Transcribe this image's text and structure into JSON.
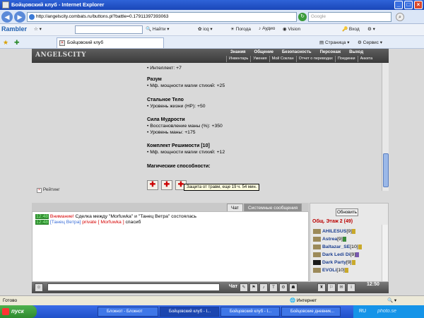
{
  "window": {
    "title": "Бойцовский клуб - Internet Explorer",
    "url": "http://angelscity.combats.ru/buttons.pl?battle=0.17911397393063",
    "search_placeholder": "Google"
  },
  "toolbar": {
    "brand": "Rambler",
    "items": [
      "Найти",
      "Погода",
      "Аудио",
      "Vision",
      "Вход"
    ],
    "icq": "icq"
  },
  "tab": {
    "title": "Бойцовский клуб",
    "page_menu": "Страница",
    "tools_menu": "Сервис"
  },
  "game": {
    "logo": "ANGELSCITY",
    "menu_top": [
      "Знания",
      "Общение",
      "Безопасность",
      "Персонаж",
      "Выход"
    ],
    "menu_bottom": [
      "Инвентарь",
      "Умения",
      "Мой Соклан",
      "Отчет о переводах",
      "Поединки",
      "Анкета"
    ],
    "partial_line": "• Интеллект: +7",
    "blocks": [
      {
        "title": "Разум",
        "lines": [
          "• Мф. мощности магии стихий: +25"
        ]
      },
      {
        "title": "Стальное Тело",
        "lines": [
          "• Уровень жизни (HP): +50"
        ]
      },
      {
        "title": "Сила Мудрости",
        "lines": [
          "• Восстановление маны (%): +350",
          "• Уровень маны: +175"
        ]
      },
      {
        "title": "Комплект Решимости [10]",
        "lines": [
          "• Мф. мощности магии стихий: +12"
        ]
      }
    ],
    "magic_title": "Магические способности:",
    "tooltip": "Защита от травм, еще 19 ч. 54 мин.",
    "rating": "Рейтинг"
  },
  "chat": {
    "tabs": [
      "Чат",
      "Системные сообщения"
    ],
    "lines": [
      {
        "time": "12:48",
        "alert": "Внимание!",
        "text": " Сделка между \"Morfuwka\" и \"Танец Ветра\" состоялась"
      },
      {
        "time": "12:48",
        "from": "[Танец Ветра]",
        "priv": " private [ Morfuwka ]",
        "text": " спасиб"
      }
    ]
  },
  "users": {
    "refresh": "Обновить",
    "floor": "Общ. Этаж 2 (49)",
    "list": [
      {
        "name": "AHILESUS",
        "level": "[9]"
      },
      {
        "name": "Astrea",
        "level": "[9]"
      },
      {
        "name": "Baltazar_SE",
        "level": "[10]"
      },
      {
        "name": "Dark Ledi Di",
        "level": "[9]"
      },
      {
        "name": "Dark Party",
        "level": "[9]"
      },
      {
        "name": "EVOLi",
        "level": "[10]"
      }
    ]
  },
  "bottombar": {
    "clock": "12:50"
  },
  "status": {
    "left": "Готово",
    "zone": "Интернет"
  },
  "taskbar": {
    "start": "пуск",
    "tasks": [
      "Блокнот - Блокнот",
      "Бойцовский клуб - I...",
      "Бойцовский клуб - I...",
      "Бойцовские дневник..."
    ],
    "lang": "RU",
    "watermark": "photo.se"
  }
}
